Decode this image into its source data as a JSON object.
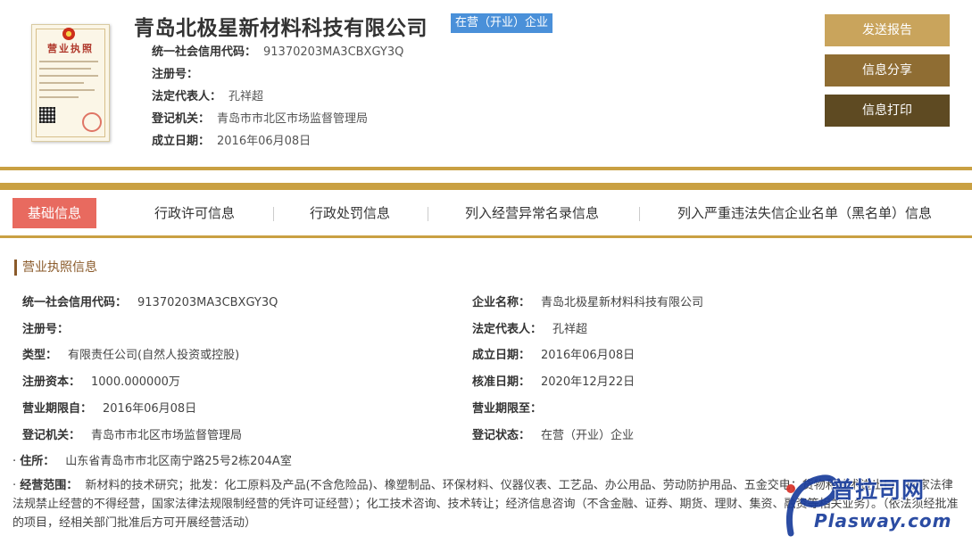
{
  "header": {
    "company_name": "青岛北极星新材料科技有限公司",
    "status_tag": "在营（开业）企业",
    "license_image_title": "营业执照",
    "rows": [
      {
        "label": "统一社会信用代码：",
        "value": "91370203MA3CBXGY3Q"
      },
      {
        "label": "注册号：",
        "value": ""
      },
      {
        "label": "法定代表人：",
        "value": "孔祥超"
      },
      {
        "label": "登记机关：",
        "value": "青岛市市北区市场监督管理局"
      },
      {
        "label": "成立日期：",
        "value": "2016年06月08日"
      }
    ],
    "buttons": {
      "send_report": "发送报告",
      "share_info": "信息分享",
      "print_info": "信息打印"
    }
  },
  "tabs": [
    {
      "label": "基础信息",
      "active": true
    },
    {
      "label": "行政许可信息",
      "active": false
    },
    {
      "label": "行政处罚信息",
      "active": false
    },
    {
      "label": "列入经营异常名录信息",
      "active": false
    },
    {
      "label": "列入严重违法失信企业名单（黑名单）信息",
      "active": false
    }
  ],
  "section": {
    "title": "营业执照信息",
    "left": [
      {
        "label": "统一社会信用代码：",
        "value": "91370203MA3CBXGY3Q"
      },
      {
        "label": "注册号：",
        "value": ""
      },
      {
        "label": "类型：",
        "value": "有限责任公司(自然人投资或控股)"
      },
      {
        "label": "注册资本：",
        "value": "1000.000000万"
      },
      {
        "label": "营业期限自：",
        "value": "2016年06月08日"
      },
      {
        "label": "登记机关：",
        "value": "青岛市市北区市场监督管理局"
      }
    ],
    "right": [
      {
        "label": "企业名称：",
        "value": "青岛北极星新材料科技有限公司"
      },
      {
        "label": "法定代表人：",
        "value": "孔祥超"
      },
      {
        "label": "成立日期：",
        "value": "2016年06月08日"
      },
      {
        "label": "核准日期：",
        "value": "2020年12月22日"
      },
      {
        "label": "营业期限至：",
        "value": ""
      },
      {
        "label": "登记状态：",
        "value": "在营（开业）企业"
      }
    ],
    "address": {
      "label": "住所：",
      "value": "山东省青岛市市北区南宁路25号2栋204A室"
    },
    "scope": {
      "label": "经营范围：",
      "value": "新材料的技术研究；批发：化工原料及产品(不含危险品)、橡塑制品、环保材料、仪器仪表、工艺品、办公用品、劳动防护用品、五金交电；货物和技术进出口（国家法律法规禁止经营的不得经营，国家法律法规限制经营的凭许可证经营）；化工技术咨询、技术转让；经济信息咨询（不含金融、证券、期货、理财、集资、融资等相关业务）。（依法须经批准的项目，经相关部门批准后方可开展经营活动）"
    }
  },
  "watermark": {
    "logo_text": "普拉司网",
    "url_text": "Plasway.com"
  },
  "colors": {
    "gold": "#c9a042",
    "tab_active": "#e86a5f",
    "status_tag": "#4a90d9",
    "btn_send": "#c9a45c",
    "btn_share": "#8f6d33",
    "btn_print": "#5e4a22"
  }
}
